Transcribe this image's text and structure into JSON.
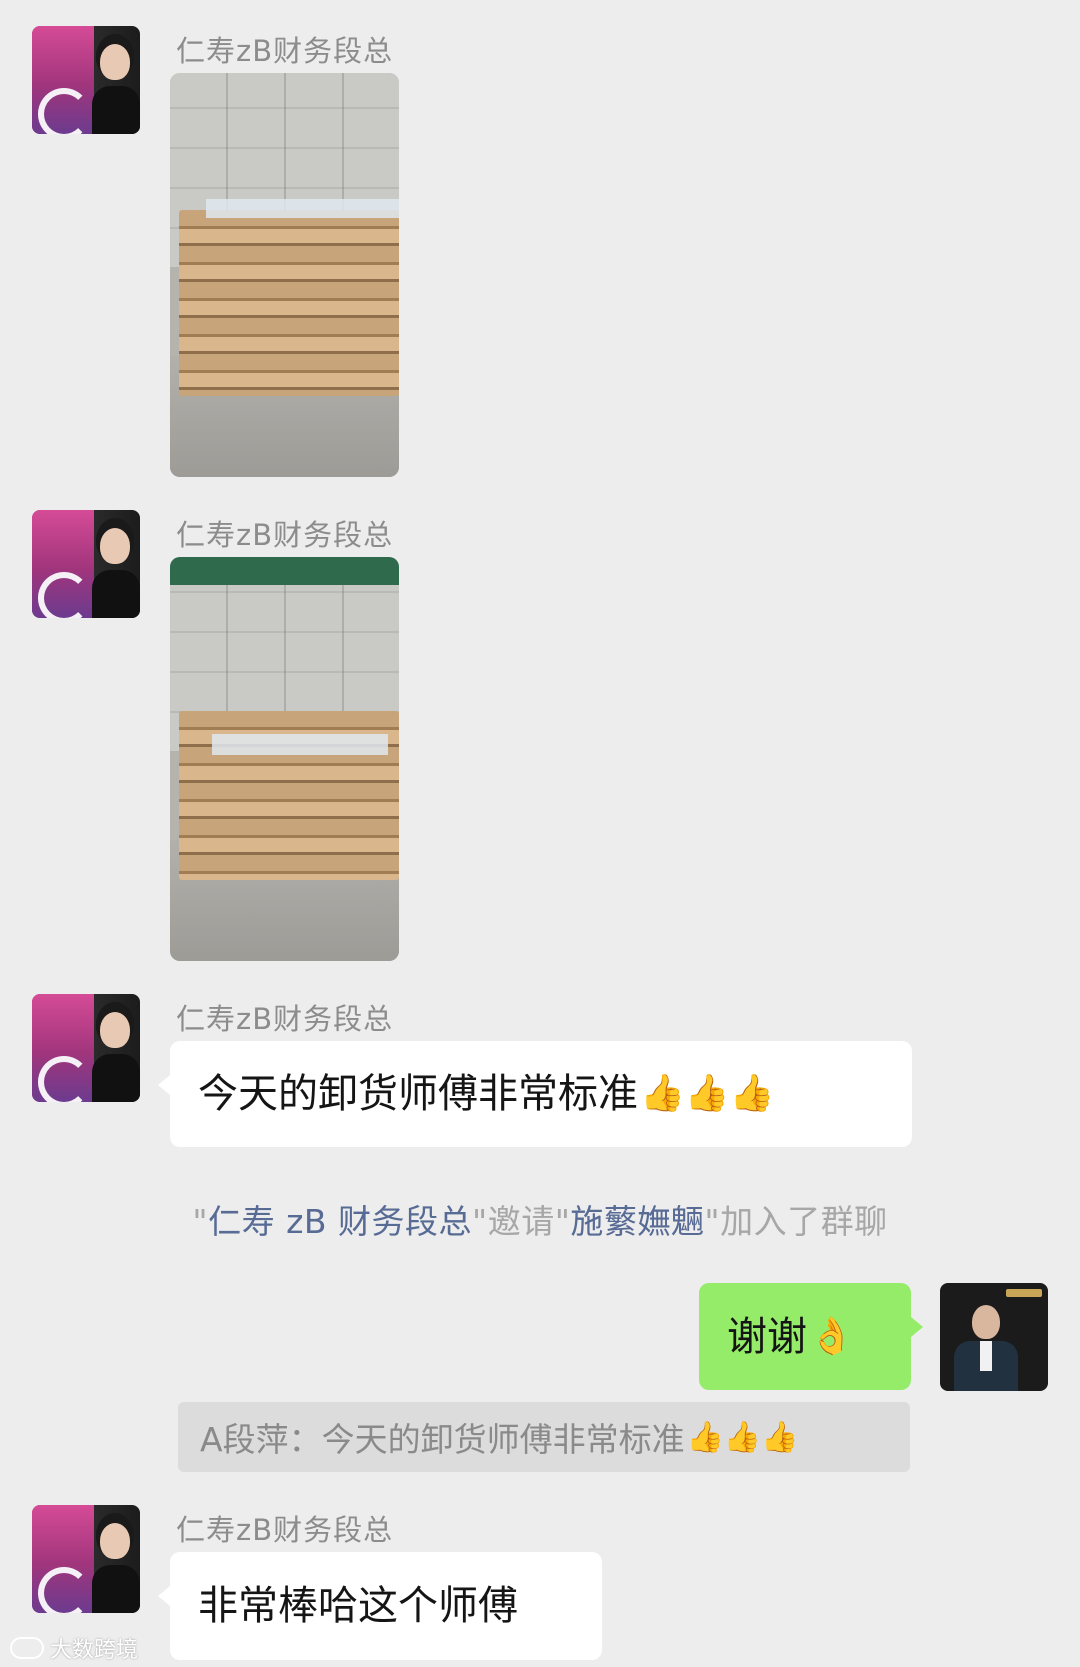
{
  "messages": [
    {
      "sender": "仁寿zB财务段总",
      "type": "image"
    },
    {
      "sender": "仁寿zB财务段总",
      "type": "image"
    },
    {
      "sender": "仁寿zB财务段总",
      "type": "text",
      "text": "今天的卸货师傅非常标准",
      "emoji": "👍👍👍"
    },
    {
      "type": "system",
      "open_quote": "\"",
      "inviter": "仁寿 zB 财务段总",
      "mid": "\"邀请\"",
      "invitee": "施蘩嫵魎",
      "end": "\"加入了群聊"
    },
    {
      "sender": "self",
      "type": "text",
      "text": "谢谢",
      "emoji": "👌"
    },
    {
      "type": "quote",
      "text": "A段萍：今天的卸货师傅非常标准",
      "emoji": "👍👍👍"
    },
    {
      "sender": "仁寿zB财务段总",
      "type": "text",
      "text": "非常棒哈这个师傅"
    }
  ],
  "watermark": "大数跨境"
}
